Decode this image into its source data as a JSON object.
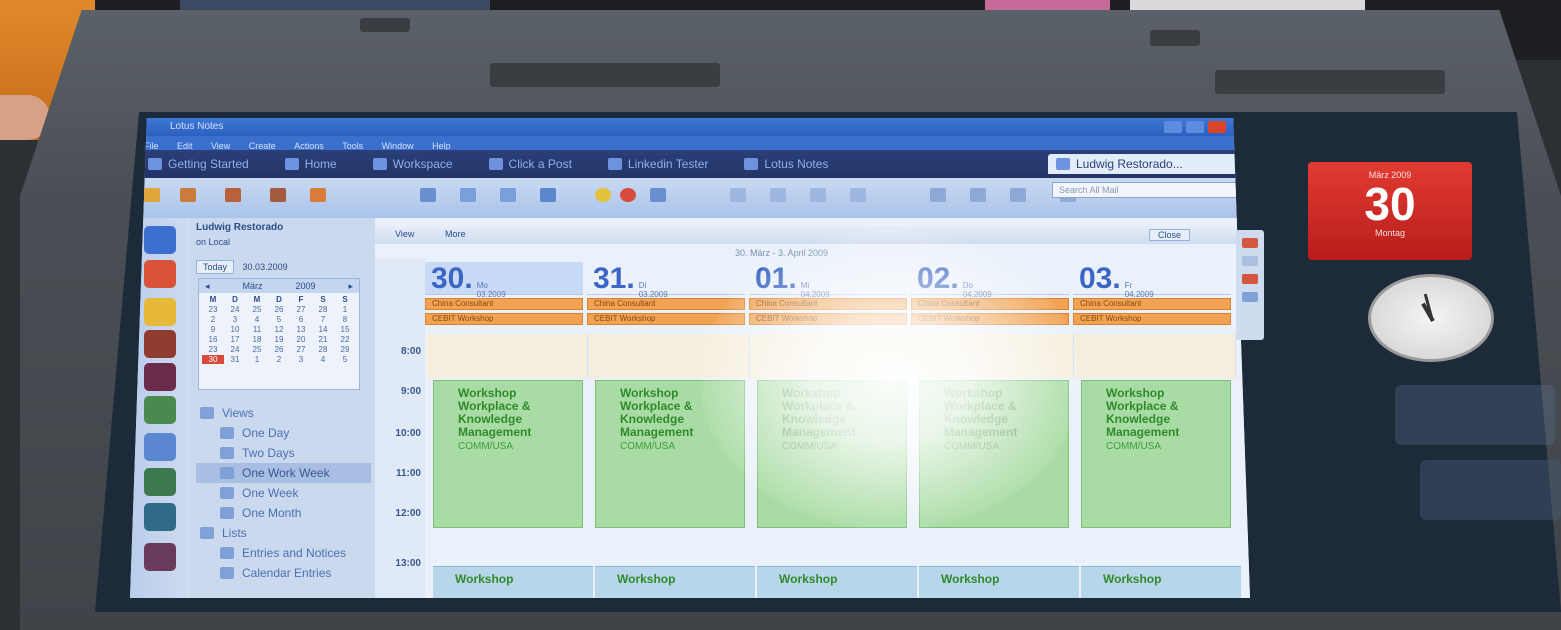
{
  "window": {
    "title": "Lotus Notes",
    "menu": [
      "File",
      "Edit",
      "View",
      "Create",
      "Actions",
      "Tools",
      "Window",
      "Help"
    ]
  },
  "tabs": [
    {
      "label": "Getting Started"
    },
    {
      "label": "Home"
    },
    {
      "label": "Workspace"
    },
    {
      "label": "Click a Post"
    },
    {
      "label": "Linkedin Tester"
    },
    {
      "label": "Lotus Notes"
    },
    {
      "label": "Ludwig Restorado..."
    }
  ],
  "search": {
    "placeholder": "Search All Mail"
  },
  "nav": {
    "owner": "Ludwig Restorado",
    "location": "on Local",
    "today_label": "Today",
    "today_date": "30.03.2009",
    "mini_calendar": {
      "month": "März",
      "year": "2009",
      "dow": [
        "M",
        "D",
        "M",
        "D",
        "F",
        "S",
        "S"
      ],
      "days": [
        "23",
        "24",
        "25",
        "26",
        "27",
        "28",
        "1",
        "2",
        "3",
        "4",
        "5",
        "6",
        "7",
        "8",
        "9",
        "10",
        "11",
        "12",
        "13",
        "14",
        "15",
        "16",
        "17",
        "18",
        "19",
        "20",
        "21",
        "22",
        "23",
        "24",
        "25",
        "26",
        "27",
        "28",
        "29",
        "30",
        "31",
        "1",
        "2",
        "3",
        "4",
        "5"
      ],
      "selected": "30"
    },
    "tree": [
      {
        "label": "Views",
        "level": 0
      },
      {
        "label": "One Day",
        "level": 1
      },
      {
        "label": "Two Days",
        "level": 1
      },
      {
        "label": "One Work Week",
        "level": 1,
        "selected": true
      },
      {
        "label": "One Week",
        "level": 1
      },
      {
        "label": "One Month",
        "level": 1
      },
      {
        "label": "Lists",
        "level": 0
      },
      {
        "label": "Entries and Notices",
        "level": 1
      },
      {
        "label": "Calendar Entries",
        "level": 1
      }
    ]
  },
  "calendar": {
    "view_label": "View",
    "nav_label": "More",
    "close_label": "Close",
    "range": "30. März - 3. April 2009",
    "times": [
      "8:00",
      "9:00",
      "10:00",
      "11:00",
      "12:00",
      "13:00"
    ],
    "days": [
      {
        "num": "30.",
        "wd": "Mo",
        "date": "03.2009",
        "today": true
      },
      {
        "num": "31.",
        "wd": "Di",
        "date": "03.2009"
      },
      {
        "num": "01.",
        "wd": "Mi",
        "date": "04.2009"
      },
      {
        "num": "02.",
        "wd": "Do",
        "date": "04.2009"
      },
      {
        "num": "03.",
        "wd": "Fr",
        "date": "04.2009"
      }
    ],
    "allday": [
      "China Consultant",
      "CEBIT Workshop"
    ],
    "event": {
      "title_lines": [
        "Workshop",
        "Workplace &",
        "Knowledge",
        "Management"
      ],
      "room": "COMM/USA"
    },
    "event2_title": "Workshop"
  },
  "gadgets": {
    "calendar": {
      "month": "März 2009",
      "day": "30",
      "weekday": "Montag"
    }
  },
  "colors": {
    "accent": "#3d66c4",
    "allday": "#f1a253",
    "event": "#a9dca4",
    "gadget_red": "#d52b24"
  }
}
